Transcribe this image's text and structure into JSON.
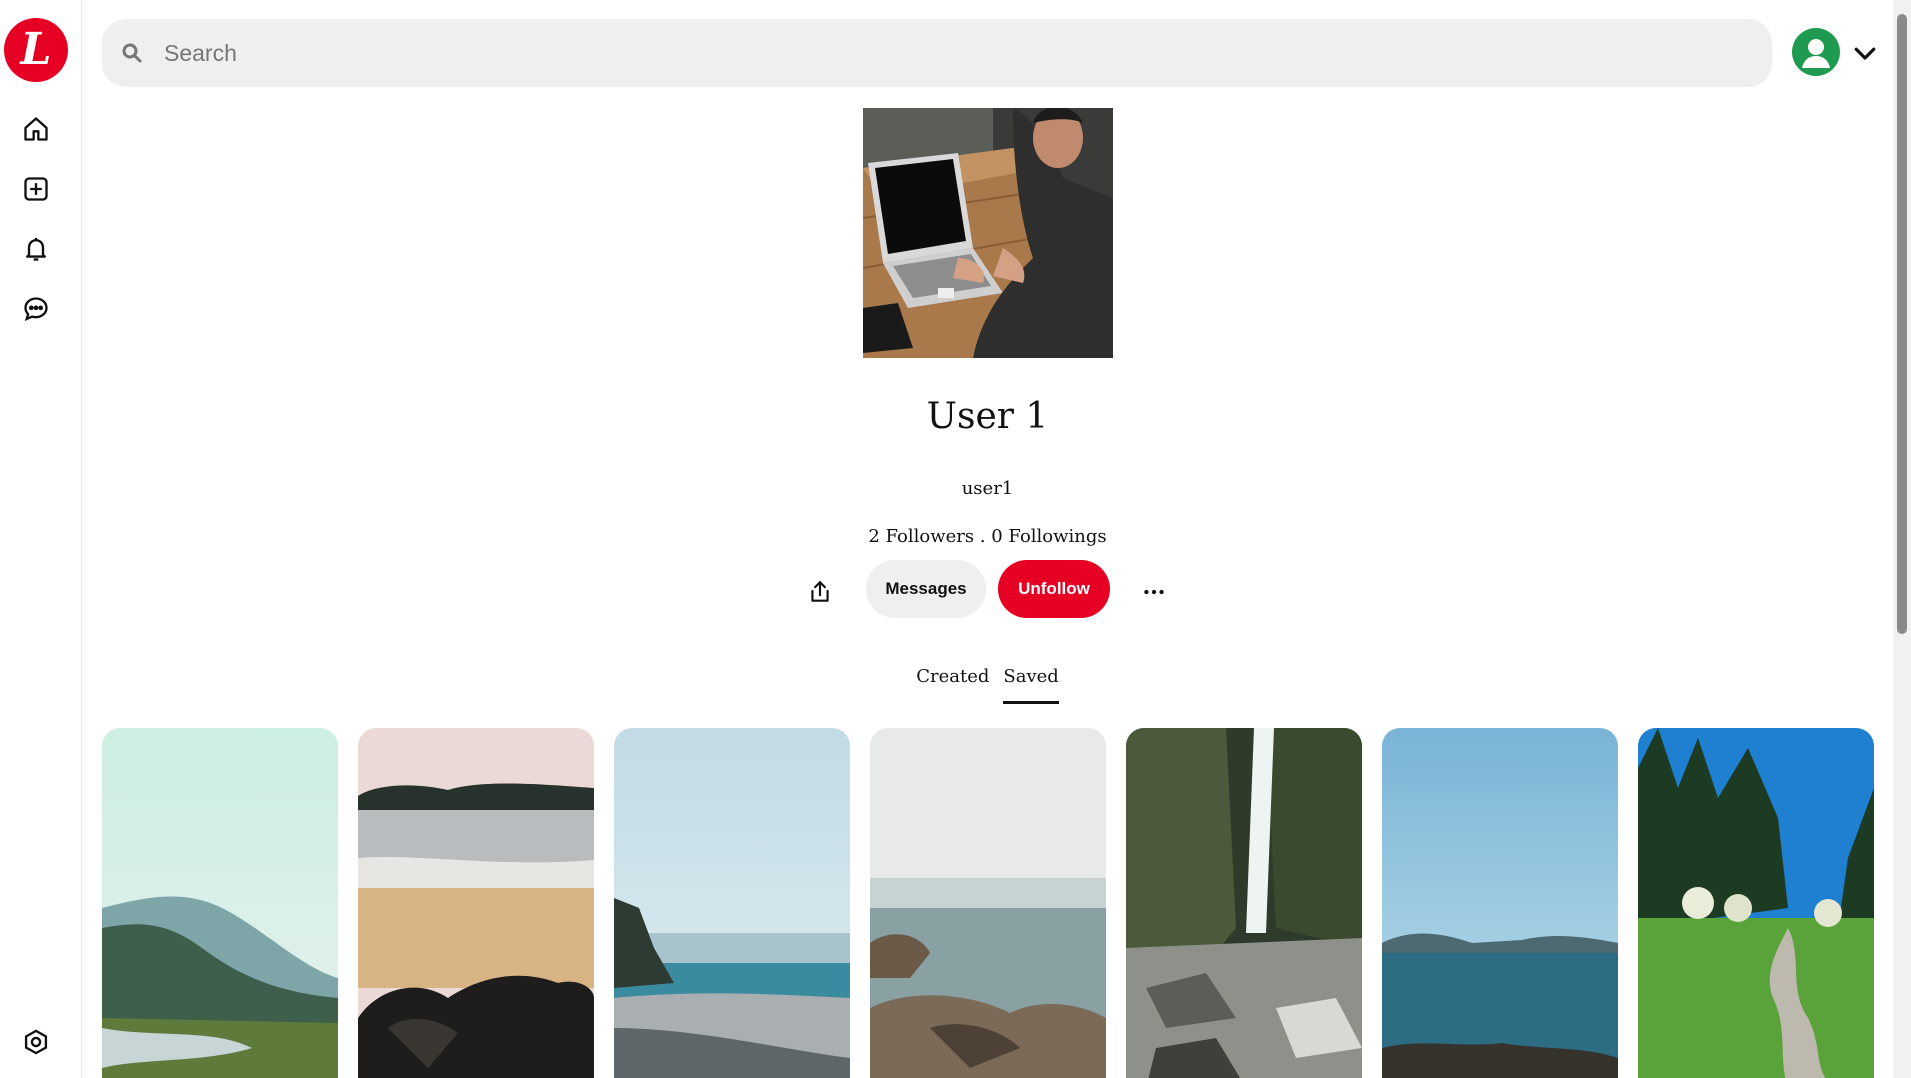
{
  "app": {
    "logo_letter": "L",
    "brand_color": "#e60023"
  },
  "search": {
    "placeholder": "Search",
    "value": ""
  },
  "sidebar": {
    "items": [
      {
        "icon": "home-icon"
      },
      {
        "icon": "create-icon"
      },
      {
        "icon": "notifications-icon"
      },
      {
        "icon": "messages-icon"
      },
      {
        "icon": "settings-icon"
      }
    ]
  },
  "header": {
    "avatar_icon": "user-avatar-icon",
    "menu_icon": "chevron-down-icon"
  },
  "profile": {
    "name": "User 1",
    "username": "user1",
    "stats": "2 Followers . 0 Followings",
    "actions": {
      "share_icon": "share-icon",
      "messages_label": "Messages",
      "unfollow_label": "Unfollow",
      "more_icon": "more-icon"
    }
  },
  "tabs": [
    {
      "label": "Created",
      "active": false
    },
    {
      "label": "Saved",
      "active": true
    }
  ],
  "pins": [
    {
      "description": "misty forest river"
    },
    {
      "description": "beach with rocks"
    },
    {
      "description": "pebble shore and sea"
    },
    {
      "description": "rocky coast in fog"
    },
    {
      "description": "waterfall in canyon"
    },
    {
      "description": "calm sea and islands"
    },
    {
      "description": "path through meadow"
    }
  ]
}
